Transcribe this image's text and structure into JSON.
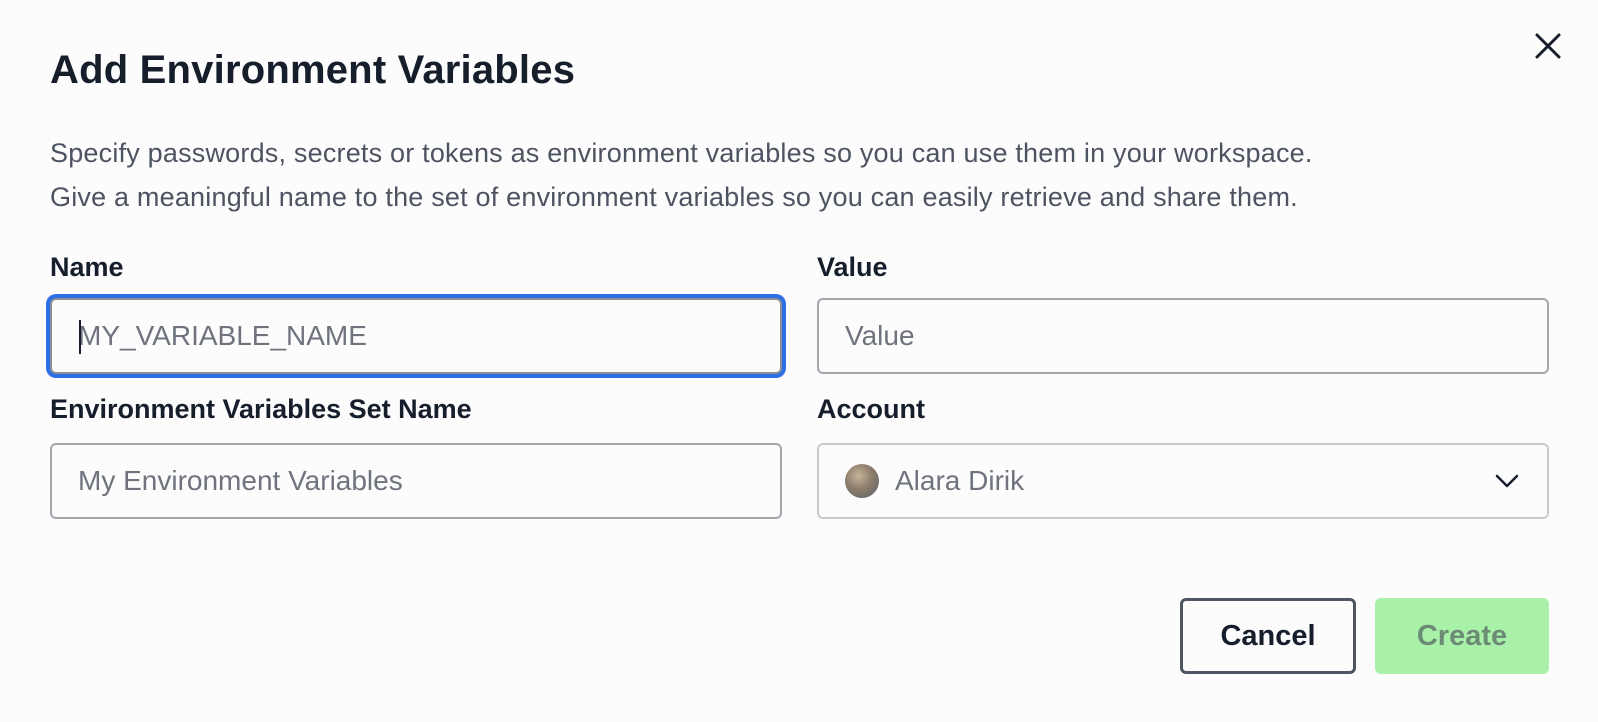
{
  "dialog": {
    "title": "Add Environment Variables",
    "description_line1": "Specify passwords, secrets or tokens as environment variables so you can use them in your workspace.",
    "description_line2": "Give a meaningful name to the set of environment variables so you can easily retrieve and share them."
  },
  "form": {
    "name": {
      "label": "Name",
      "placeholder": "MY_VARIABLE_NAME",
      "value": ""
    },
    "value": {
      "label": "Value",
      "placeholder": "Value",
      "value": ""
    },
    "set_name": {
      "label": "Environment Variables Set Name",
      "placeholder": "My Environment Variables",
      "value": ""
    },
    "account": {
      "label": "Account",
      "selected": "Alara Dirik"
    }
  },
  "actions": {
    "cancel_label": "Cancel",
    "create_label": "Create"
  },
  "icons": {
    "close": "close-icon",
    "chevron": "chevron-down-icon",
    "avatar": "avatar"
  },
  "colors": {
    "focus_ring": "#2f6fe4",
    "create_bg": "#a9f0a9",
    "create_text": "#6c8b75",
    "text_primary": "#161d2b",
    "text_muted": "#4d5360"
  }
}
